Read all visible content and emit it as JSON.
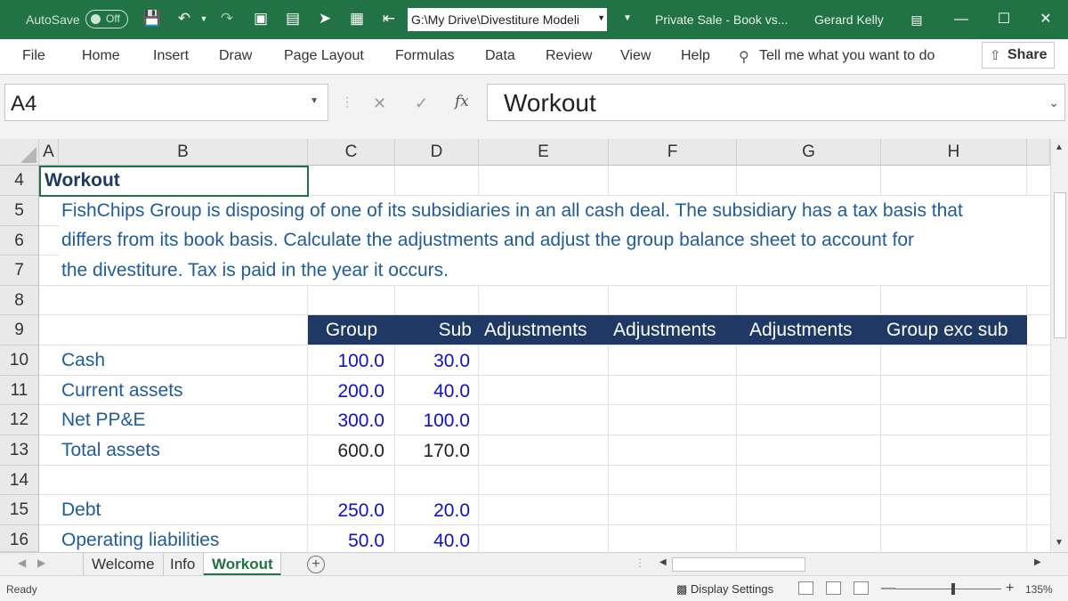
{
  "titlebar": {
    "autosave_label": "AutoSave",
    "autosave_state": "Off",
    "file_path": "G:\\My Drive\\Divestiture Modeli",
    "document_title": "Private Sale - Book vs...",
    "user_name": "Gerard Kelly"
  },
  "ribbon": {
    "tabs": [
      "File",
      "Home",
      "Insert",
      "Draw",
      "Page Layout",
      "Formulas",
      "Data",
      "Review",
      "View",
      "Help"
    ],
    "tell_me": "Tell me what you want to do",
    "share": "Share"
  },
  "formula_bar": {
    "name_box": "A4",
    "fx": "fx",
    "content": "Workout"
  },
  "columns": [
    "A",
    "B",
    "C",
    "D",
    "E",
    "F",
    "G",
    "H"
  ],
  "rows": [
    "4",
    "5",
    "6",
    "7",
    "8",
    "9",
    "10",
    "11",
    "12",
    "13",
    "14",
    "15",
    "16"
  ],
  "sheet": {
    "title": "Workout",
    "description": [
      "FishChips Group is disposing of one of its subsidiaries in an all cash deal. The subsidiary has a tax basis that",
      "differs from its book basis. Calculate the adjustments and adjust the group balance sheet to account for",
      "the divestiture. Tax is paid in the year it occurs."
    ],
    "table_headers": [
      "Group",
      "Sub",
      "Adjustments",
      "Adjustments",
      "Adjustments",
      "Group exc sub"
    ],
    "table_rows": [
      {
        "label": "Cash",
        "group": "100.0",
        "sub": "30.0"
      },
      {
        "label": "Current assets",
        "group": "200.0",
        "sub": "40.0"
      },
      {
        "label": "Net PP&E",
        "group": "300.0",
        "sub": "100.0"
      },
      {
        "label": "Total assets",
        "group": "600.0",
        "sub": "170.0"
      },
      {
        "label": "",
        "group": "",
        "sub": ""
      },
      {
        "label": "Debt",
        "group": "250.0",
        "sub": "20.0"
      },
      {
        "label": "Operating liabilities",
        "group": "50.0",
        "sub": "40.0"
      }
    ]
  },
  "sheet_tabs": [
    "Welcome",
    "Info",
    "Workout"
  ],
  "active_sheet": "Workout",
  "status": {
    "ready": "Ready",
    "display_settings": "Display Settings",
    "zoom": "135%"
  },
  "colors": {
    "excel_green": "#217346",
    "header_band": "#1f3864",
    "input_blue": "#1010c8",
    "label_blue": "#1f5c99"
  }
}
